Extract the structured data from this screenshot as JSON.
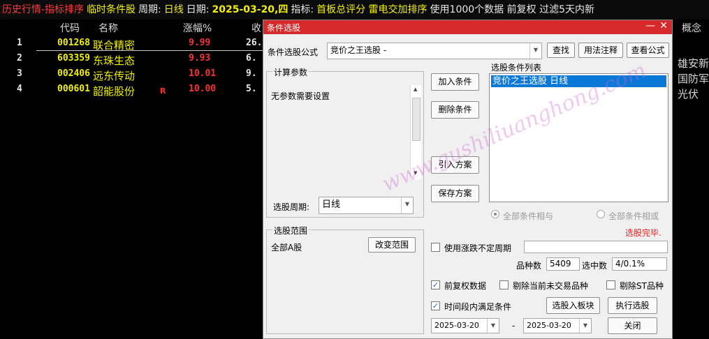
{
  "topbar": {
    "title": "历史行情-指标排序",
    "list_name": "临时条件股",
    "period_label": "周期:",
    "period_value": "日线",
    "date_label": "日期:",
    "date_value": "2025-03-20,四",
    "indicator_label": "指标:",
    "indicator_value": "首板总评分 雷电交加排序",
    "info": "使用1000个数据 前复权 过滤5天内新"
  },
  "table": {
    "headers": [
      "代码",
      "名称",
      "涨幅%",
      "收"
    ],
    "rows": [
      {
        "index": "1",
        "code": "001268",
        "name": "联合精密",
        "badge": "",
        "change": "9.99",
        "close": "26."
      },
      {
        "index": "2",
        "code": "603359",
        "name": "东珠生态",
        "badge": "",
        "change": "9.93",
        "close": "6."
      },
      {
        "index": "3",
        "code": "002406",
        "name": "远东传动",
        "badge": "",
        "change": "10.01",
        "close": "9."
      },
      {
        "index": "4",
        "code": "000601",
        "name": "韶能股份",
        "badge": "R",
        "change": "10.00",
        "close": "5."
      }
    ]
  },
  "right_panel": {
    "header": "概念",
    "items": [
      "雄安新",
      "国防军",
      "光伏"
    ]
  },
  "dialog": {
    "title": "条件选股",
    "formula_label": "条件选股公式",
    "formula_value": "竞价之王选股  -",
    "find_button": "查找",
    "usage_button": "用法注释",
    "view_formula_button": "查看公式",
    "params_group": "计算参数",
    "params_text": "无参数需要设置",
    "period_label": "选股周期:",
    "period_value": "日线",
    "add_condition": "加入条件",
    "delete_condition": "删除条件",
    "import_plan": "引入方案",
    "save_plan": "保存方案",
    "condition_list_label": "选股条件列表",
    "condition_items": [
      "竞价之王选股  日线"
    ],
    "radio_all_and": "全部条件相与",
    "radio_all_or": "全部条件相或",
    "status": "选股完毕.",
    "range_group": "选股范围",
    "range_value": "全部A股",
    "change_range_button": "改变范围",
    "use_limit_period": "使用涨跌不定周期",
    "count_label": "品种数",
    "count_value": "5409",
    "selected_label": "选中数",
    "selected_value": "4/0.1%",
    "adjust_data": "前复权数据",
    "exclude_untraded": "剔除当前未交易品种",
    "exclude_st": "剔除ST品种",
    "time_range": "时间段内满足条件",
    "to_block_button": "选股入板块",
    "execute_button": "执行选股",
    "date_from": "2025-03-20",
    "date_sep": "-",
    "date_to": "2025-03-20",
    "close_button": "关闭"
  },
  "watermark": "www.gushiliuanghong.com",
  "colors": {
    "background": "#000000",
    "title_red": "#ff3b3b",
    "yellow": "#f2f200",
    "up_red": "#ff3030",
    "dialog_title": "#d62a2a",
    "selection_blue": "#0a78d7"
  }
}
